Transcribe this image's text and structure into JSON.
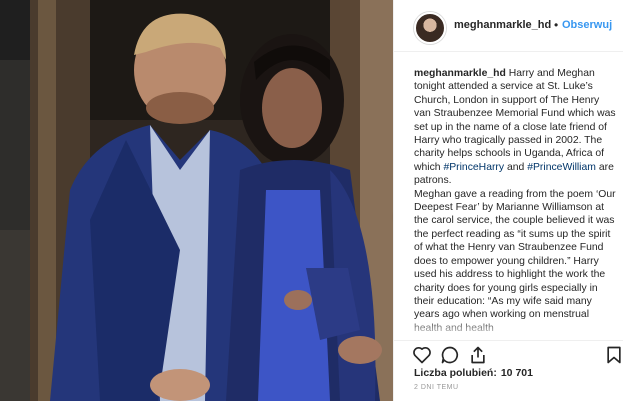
{
  "post": {
    "username": "meghanmarkle_hd",
    "follow_label": "Obserwuj",
    "separator": "•",
    "next_label": "›",
    "caption": {
      "username": "meghanmarkle_hd",
      "part1": " Harry and Meghan tonight attended a service at St. Luke’s Church, London in support of The Henry van Straubenzee Memorial Fund which was set up in the name of a close late friend of Harry who tragically passed in 2002. The charity helps schools in Uganda, Africa of which ",
      "tag1": "#PrinceHarry",
      "part2": " and ",
      "tag2": "#PrinceWilliam",
      "part3": " are patrons.",
      "part4": "Meghan gave a reading from the poem ‘Our Deepest Fear’ by Marianne Williamson at the carol service, the couple believed it was the perfect reading as “it sums up the spirit of what the Henry van Straubenzee Fund does to empower young children.” Harry used his address to highlight the work the charity does for young girls especially in their education: “As my wife said many years ago when working on menstrual health and health"
    },
    "likes_label": "Liczba polubień:",
    "likes_count": "10 701",
    "time_label": "2 DNI TEMU",
    "icons": [
      "heart-icon",
      "comment-icon",
      "share-icon",
      "bookmark-icon",
      "chevron-right-icon"
    ],
    "colors": {
      "accent": "#3897f0",
      "hashtag": "#003569",
      "text": "#262626",
      "muted": "#999999"
    }
  }
}
